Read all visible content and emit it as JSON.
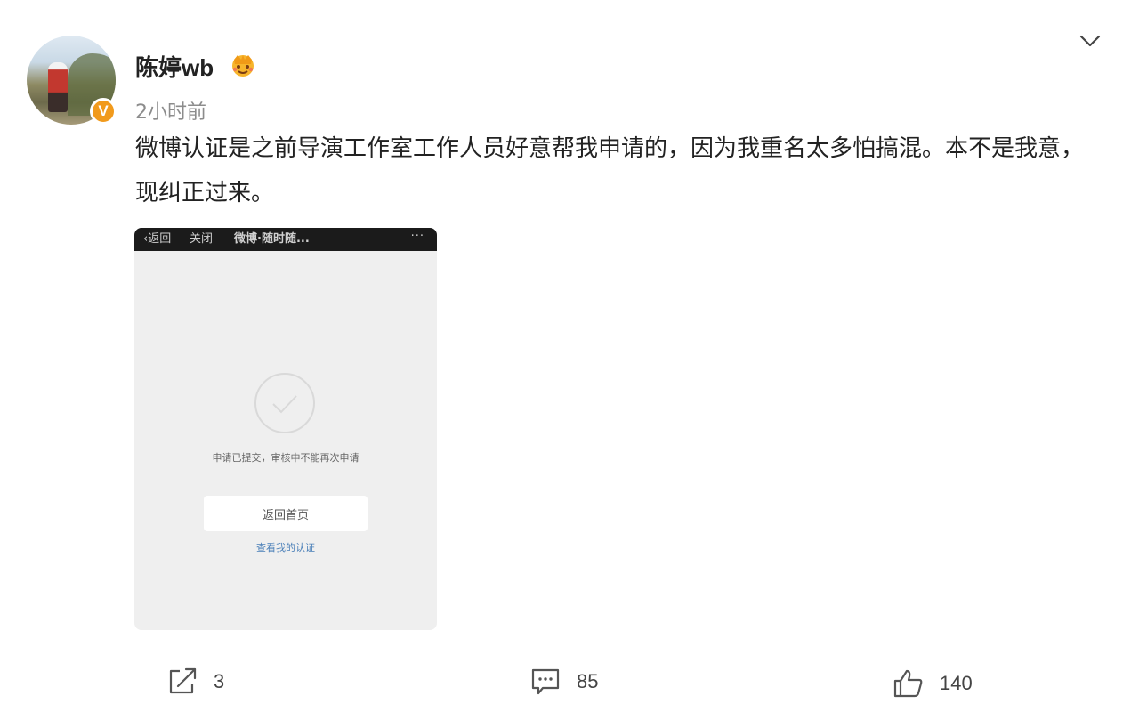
{
  "post": {
    "username": "陈婷wb",
    "time": "2小时前",
    "verified_badge": "V",
    "text": "微博认证是之前导演工作室工作人员好意帮我申请的，因为我重名太多怕搞混。本不是我意，现纠正过来。"
  },
  "screenshot": {
    "topbar": {
      "back": "‹返回",
      "close": "关闭",
      "title": "微博·随时随...",
      "more": "···"
    },
    "message": "申请已提交，审核中不能再次申请",
    "home_button": "返回首页",
    "view_link": "查看我的认证"
  },
  "actions": {
    "repost_count": "3",
    "comment_count": "85",
    "like_count": "140"
  },
  "icons": {
    "member": "member-vip-icon",
    "chevron": "chevron-down-icon",
    "repost": "repost-icon",
    "comment": "comment-icon",
    "like": "thumbs-up-icon",
    "check": "check-circle-icon"
  },
  "colors": {
    "badge_orange": "#f19a1c",
    "link_blue": "#4a7fb8",
    "text_dark": "#222222",
    "text_gray": "#8c8c8c"
  }
}
